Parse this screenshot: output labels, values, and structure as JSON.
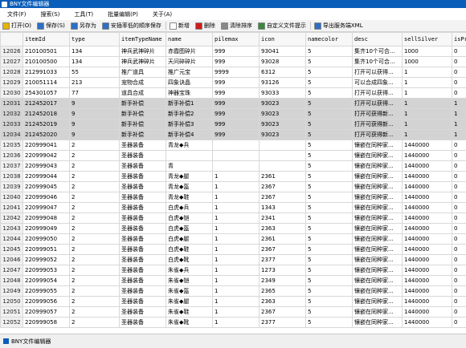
{
  "title": "BNY文件编辑器",
  "menu": [
    "文件(F)",
    "搜索(S)",
    "工具(T)",
    "批量编辑(P)",
    "关于(A)"
  ],
  "toolbar": [
    {
      "label": "打开(O)",
      "icon": "folder-open-icon",
      "color": "#e6b400"
    },
    {
      "label": "保存(S)",
      "icon": "save-icon",
      "color": "#2d6fc4"
    },
    {
      "label": "另存为",
      "icon": "save-as-icon",
      "color": "#2d6fc4"
    },
    {
      "label": "安插率低的顺序保存",
      "icon": "save-order-icon",
      "color": "#2d6fc4"
    },
    {
      "label": "新增",
      "icon": "new-icon",
      "color": "#ffffff"
    },
    {
      "label": "删除",
      "icon": "delete-icon",
      "color": "#d01c1c"
    },
    {
      "label": "清除排序",
      "icon": "clear-sort-icon",
      "color": "#888888"
    },
    {
      "label": "自定义文件提示",
      "icon": "custom-file-icon",
      "color": "#3a8a3a"
    },
    {
      "label": "导出服务端XML",
      "icon": "export-xml-icon",
      "color": "#2d6fc4"
    }
  ],
  "columns": [
    "itemId",
    "type",
    "itemTypeName",
    "name",
    "pilemax",
    "icon",
    "namecolor",
    "desc",
    "sellSilver",
    "isPro"
  ],
  "rows": [
    [
      "12026",
      "210100501",
      "134",
      "神兵武神碎片",
      "赤霞图碎片",
      "999",
      "93041",
      "5",
      "集齐10个可合...",
      "1000",
      "0"
    ],
    [
      "12027",
      "210100500",
      "134",
      "神兵武神碎片",
      "天问碎碎片",
      "999",
      "93028",
      "5",
      "集齐10个可合...",
      "1000",
      "0"
    ],
    [
      "12028",
      "212991033",
      "55",
      "推广道具",
      "推广元宝",
      "9999",
      "6312",
      "5",
      "打开可以获得...",
      "1",
      "0"
    ],
    [
      "12029",
      "210051114",
      "213",
      "宠物合成",
      "四象诀晶",
      "999",
      "93126",
      "5",
      "可以合成四象...",
      "1",
      "0"
    ],
    [
      "12030",
      "254301057",
      "77",
      "道具合成",
      "神器宝珠",
      "999",
      "93033",
      "5",
      "打开可以获得...",
      "1",
      "0"
    ],
    [
      "12031",
      "212452017",
      "9",
      "新手补偿",
      "新手补偿1",
      "999",
      "93023",
      "5",
      "打开可以获得...",
      "1",
      "1"
    ],
    [
      "12032",
      "212452018",
      "9",
      "新手补偿",
      "新手补偿2",
      "999",
      "93023",
      "5",
      "打开可获得新...",
      "1",
      "1"
    ],
    [
      "12033",
      "212452019",
      "9",
      "新手补偿",
      "新手补偿3",
      "999",
      "93023",
      "5",
      "打开可获得新...",
      "1",
      "1"
    ],
    [
      "12034",
      "212452020",
      "9",
      "新手补偿",
      "新手补偿4",
      "999",
      "93023",
      "5",
      "打开可获得新...",
      "1",
      "1"
    ],
    [
      "12035",
      "220999041",
      "2",
      "圣器装备",
      "青龙◆兵",
      "",
      "",
      "5",
      "镶嵌在同种家...",
      "1440000",
      "0"
    ],
    [
      "12036",
      "220999042",
      "2",
      "圣器装备",
      "",
      "",
      "",
      "5",
      "镶嵌在同种家...",
      "1440000",
      "0"
    ],
    [
      "12037",
      "220999043",
      "2",
      "圣器装备",
      "青",
      "",
      "",
      "5",
      "镶嵌在同种家...",
      "1440000",
      "0"
    ],
    [
      "12038",
      "220999044",
      "2",
      "圣器装备",
      "青龙◆腿",
      "1",
      "2361",
      "5",
      "镶嵌在同种家...",
      "1440000",
      "0"
    ],
    [
      "12039",
      "220999045",
      "2",
      "圣器装备",
      "青龙◆盔",
      "1",
      "2367",
      "5",
      "镶嵌在同种家...",
      "1440000",
      "0"
    ],
    [
      "12040",
      "220999046",
      "2",
      "圣器装备",
      "青龙◆鞋",
      "1",
      "2367",
      "5",
      "镶嵌在同种家...",
      "1440000",
      "0"
    ],
    [
      "12041",
      "220999047",
      "2",
      "圣器装备",
      "白虎◆兵",
      "1",
      "1343",
      "5",
      "镶嵌在同种家...",
      "1440000",
      "0"
    ],
    [
      "12042",
      "220999048",
      "2",
      "圣器装备",
      "白虎◆铠",
      "1",
      "2341",
      "5",
      "镶嵌在同种家...",
      "1440000",
      "0"
    ],
    [
      "12043",
      "220999049",
      "2",
      "圣器装备",
      "白虎◆盔",
      "1",
      "2363",
      "5",
      "镶嵌在同种家...",
      "1440000",
      "0"
    ],
    [
      "12044",
      "220999050",
      "2",
      "圣器装备",
      "白虎◆腿",
      "1",
      "2361",
      "5",
      "镶嵌在同种家...",
      "1440000",
      "0"
    ],
    [
      "12045",
      "220999051",
      "2",
      "圣器装备",
      "白虎◆鞋",
      "1",
      "2367",
      "5",
      "镶嵌在同种家...",
      "1440000",
      "0"
    ],
    [
      "12046",
      "220999052",
      "2",
      "圣器装备",
      "白虎◆靴",
      "1",
      "2377",
      "5",
      "镶嵌在同种家...",
      "1440000",
      "0"
    ],
    [
      "12047",
      "220999053",
      "2",
      "圣器装备",
      "朱雀◆兵",
      "1",
      "1273",
      "5",
      "镶嵌在同种家...",
      "1440000",
      "0"
    ],
    [
      "12048",
      "220999054",
      "2",
      "圣器装备",
      "朱雀◆铠",
      "1",
      "2349",
      "5",
      "镶嵌在同种家...",
      "1440000",
      "0"
    ],
    [
      "12049",
      "220999055",
      "2",
      "圣器装备",
      "朱雀◆盔",
      "1",
      "2365",
      "5",
      "镶嵌在同种家...",
      "1440000",
      "0"
    ],
    [
      "12050",
      "220999056",
      "2",
      "圣器装备",
      "朱雀◆腿",
      "1",
      "2363",
      "5",
      "镶嵌在同种家...",
      "1440000",
      "0"
    ],
    [
      "12051",
      "220999057",
      "2",
      "圣器装备",
      "朱雀◆鞋",
      "1",
      "2367",
      "5",
      "镶嵌在同种家...",
      "1440000",
      "0"
    ],
    [
      "12052",
      "220999058",
      "2",
      "圣器装备",
      "朱雀◆靴",
      "1",
      "2377",
      "5",
      "镶嵌在同种家...",
      "1440000",
      "0"
    ]
  ],
  "selected_rows": [
    5,
    6,
    7,
    8
  ],
  "statusbar": {
    "title": "BNY文件编辑器"
  }
}
